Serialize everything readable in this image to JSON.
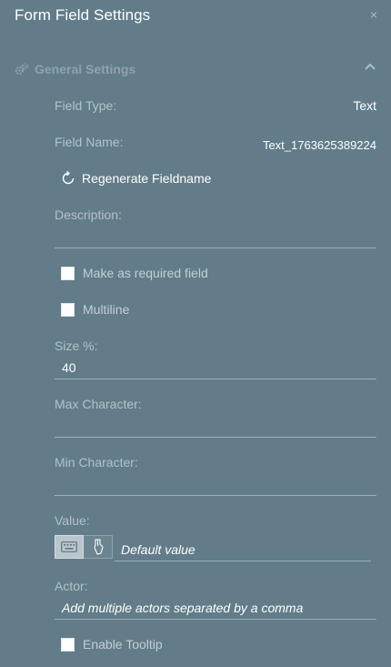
{
  "header": {
    "title": "Form Field Settings",
    "close_label": "×"
  },
  "section": {
    "title": "General Settings",
    "icon": "gears-icon",
    "expanded": true
  },
  "fields": {
    "field_type_label": "Field Type:",
    "field_type_value": "Text",
    "field_name_label": "Field Name:",
    "field_name_value": "Text_1763625389224",
    "regenerate_label": "Regenerate Fieldname",
    "description_label": "Description:",
    "description_value": "",
    "required_label": "Make as required field",
    "required_checked": false,
    "multiline_label": "Multiline",
    "multiline_checked": false,
    "size_label": "Size %:",
    "size_value": "40",
    "max_char_label": "Max Character:",
    "max_char_value": "",
    "min_char_label": "Min Character:",
    "min_char_value": "",
    "value_label": "Value:",
    "value_placeholder": "Default value",
    "value_modes": [
      "keyboard-icon",
      "signature-pen-icon"
    ],
    "value_mode_selected": "keyboard-icon",
    "actor_label": "Actor:",
    "actor_placeholder": "Add multiple actors separated by a comma",
    "tooltip_label": "Enable Tooltip",
    "tooltip_checked": false
  },
  "colors": {
    "background": "#627c89",
    "label": "#b3c2c9",
    "section_title": "#8ea2ad",
    "text": "#ffffff",
    "divider": "#9fb0b8"
  }
}
